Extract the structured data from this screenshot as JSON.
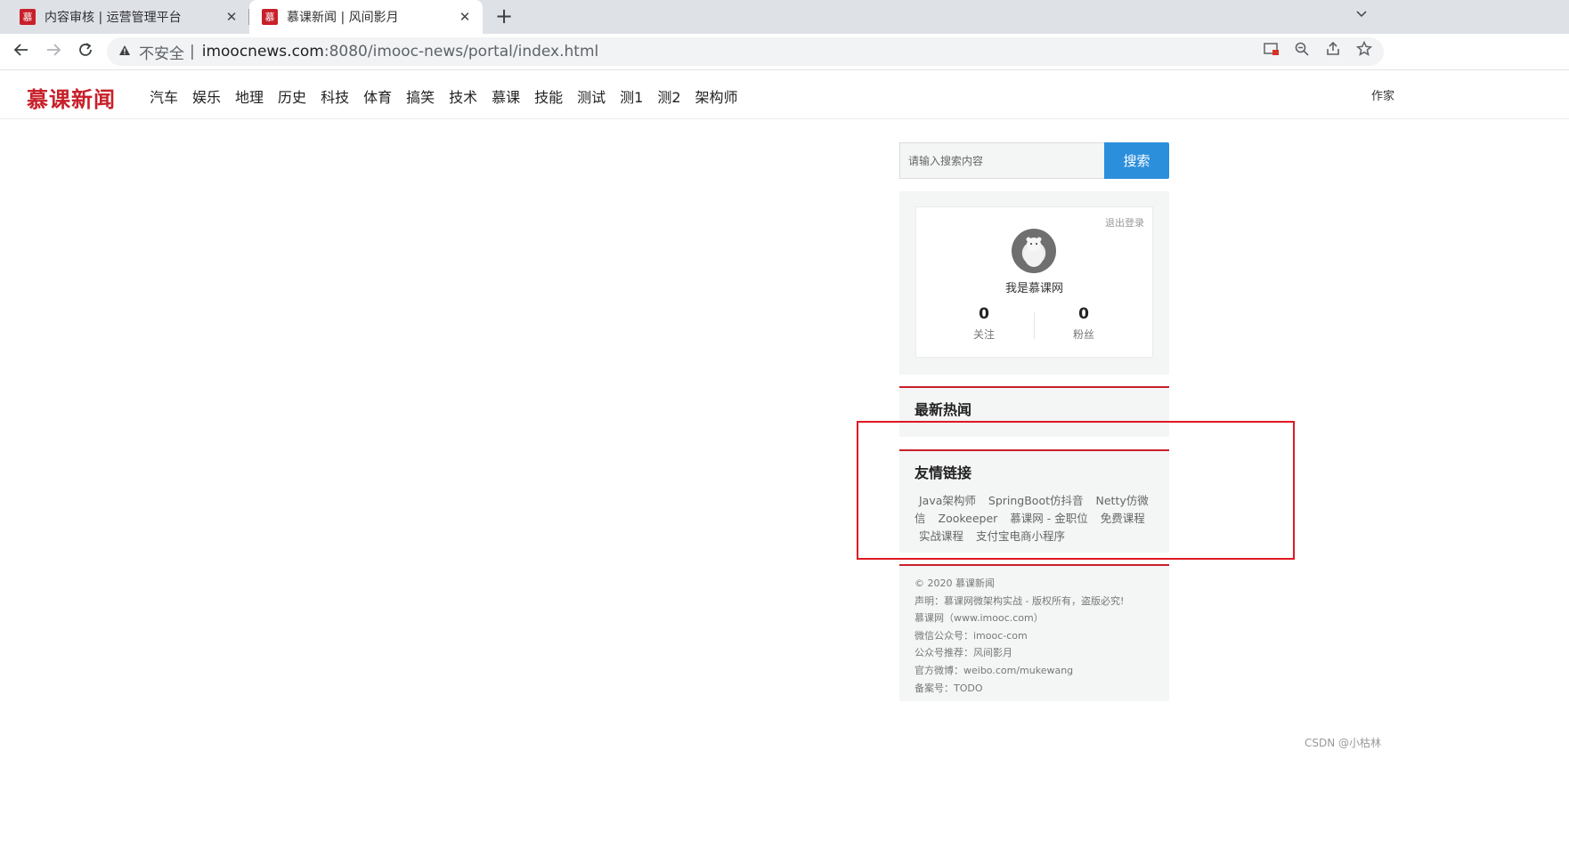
{
  "browser": {
    "tabs": [
      {
        "favicon": "慕",
        "title": "内容审核 | 运营管理平台",
        "close": "✕"
      },
      {
        "favicon": "慕",
        "title": "慕课新闻 | 风间影月",
        "close": "✕"
      }
    ],
    "new_tab": "+",
    "tab_search_icon": "chevron-down-icon",
    "not_secure": "不安全",
    "url_host": "imoocnews.com",
    "url_rest": ":8080/imooc-news/portal/index.html"
  },
  "site": {
    "logo": "慕课新闻",
    "nav": [
      "汽车",
      "娱乐",
      "地理",
      "历史",
      "科技",
      "体育",
      "搞笑",
      "技术",
      "慕课",
      "技能",
      "测试",
      "测1",
      "测2",
      "架构师"
    ],
    "header_right": "作家"
  },
  "search": {
    "placeholder": "请输入搜索内容",
    "button": "搜索"
  },
  "user": {
    "logout": "退出登录",
    "nickname": "我是慕课网",
    "follow_count": "0",
    "follow_label": "关注",
    "fans_count": "0",
    "fans_label": "粉丝"
  },
  "hot_news": {
    "title": "最新热闻"
  },
  "friend_links": {
    "title": "友情链接",
    "items": [
      "Java架构师",
      "SpringBoot仿抖音",
      "Netty仿微信",
      "Zookeeper",
      "慕课网 - 金职位",
      "免费课程",
      "实战课程",
      "支付宝电商小程序"
    ]
  },
  "footer": {
    "lines": [
      "© 2020 慕课新闻",
      "声明：慕课网微架构实战 - 版权所有，盗版必究!",
      "慕课网（www.imooc.com）",
      "微信公众号：imooc-com",
      "公众号推荐：风间影月",
      "官方微博：weibo.com/mukewang",
      "备案号：TODO"
    ]
  },
  "watermark": "CSDN @小枯林",
  "colors": {
    "brand_red": "#c8202a",
    "search_blue": "#2c8fdc",
    "highlight_red": "#e01822"
  }
}
